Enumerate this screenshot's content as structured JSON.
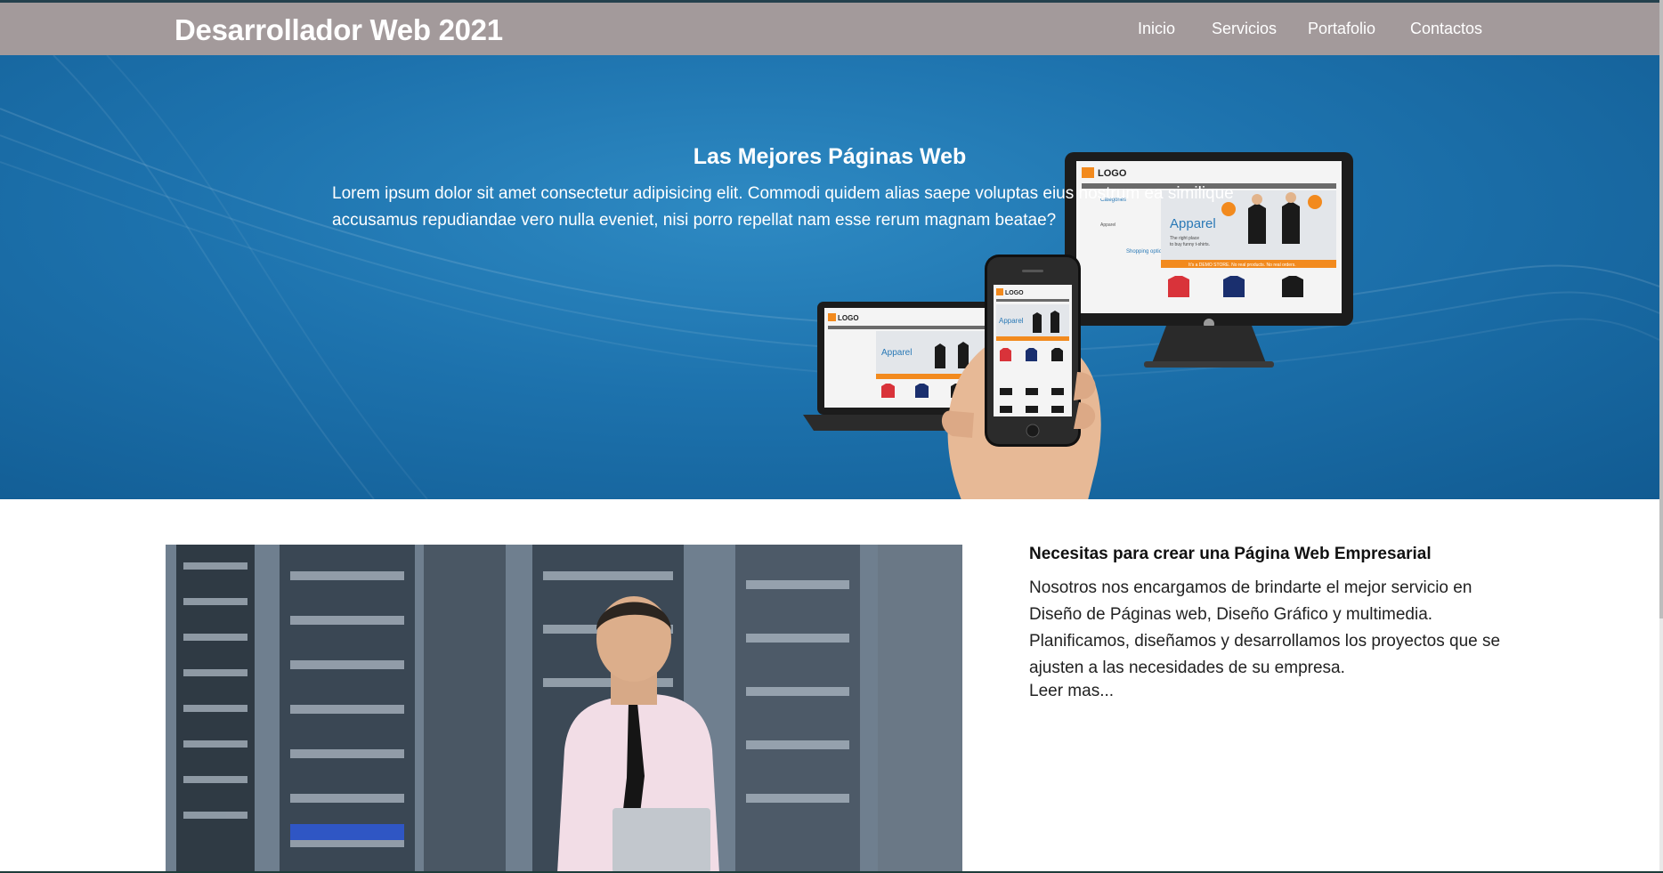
{
  "navbar": {
    "brand": "Desarrollador Web 2021",
    "links": [
      "Inicio",
      "Servicios",
      "Portafolio",
      "Contactos"
    ]
  },
  "hero": {
    "title": "Las Mejores Páginas Web",
    "text": "Lorem ipsum dolor sit amet consectetur adipisicing elit. Commodi quidem alias saepe voluptas eius nostrum ea similique accusamus repudiandae vero nulla eveniet, nisi porro repellat nam esse rerum magnam beatae?",
    "mockup": {
      "logo": "LOGO",
      "banner_title": "Apparel",
      "banner_sub_line1": "The right place",
      "banner_sub_line2": "to buy funny t-shirts.",
      "demo_strip": "It's a DEMO STORE. No real products. No real orders.",
      "sidebar_categories": "Categories",
      "sidebar_item": "Apparel",
      "sidebar_options": "Shopping options"
    }
  },
  "content": {
    "title": "Necesitas para crear una Página Web Empresarial",
    "text": "Nosotros nos encargamos de brindarte el mejor servicio en Diseño de Páginas web, Diseño Gráfico y multimedia. Planificamos, diseñamos y desarrollamos los proyectos que se ajusten a las necesidades de su empresa.",
    "read_more": "Leer mas..."
  },
  "colors": {
    "navbar": "#a39a9b",
    "hero_blue": "#1d72ad",
    "accent_orange": "#f28a1e"
  }
}
